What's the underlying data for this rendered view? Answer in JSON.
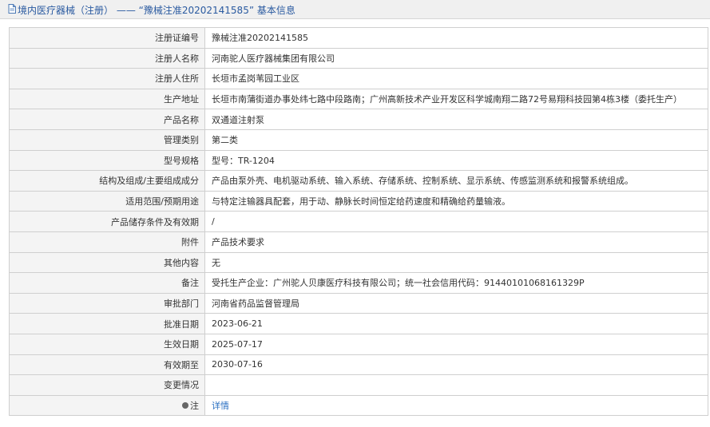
{
  "header": {
    "title": "境内医疗器械（注册） —— “豫械注准20202141585” 基本信息"
  },
  "rows": [
    {
      "label": "注册证编号",
      "value": "豫械注准20202141585"
    },
    {
      "label": "注册人名称",
      "value": "河南驼人医疗器械集团有限公司"
    },
    {
      "label": "注册人住所",
      "value": "长垣市孟岗苇园工业区"
    },
    {
      "label": "生产地址",
      "value": "长垣市南蒲街道办事处纬七路中段路南；广州高新技术产业开发区科学城南翔二路72号易翔科技园第4栋3楼（委托生产）"
    },
    {
      "label": "产品名称",
      "value": "双通道注射泵"
    },
    {
      "label": "管理类别",
      "value": "第二类"
    },
    {
      "label": "型号规格",
      "value": "型号：TR-1204"
    },
    {
      "label": "结构及组成/主要组成成分",
      "value": "产品由泵外壳、电机驱动系统、输入系统、存储系统、控制系统、显示系统、传感监测系统和报警系统组成。"
    },
    {
      "label": "适用范围/预期用途",
      "value": "与特定注输器具配套，用于动、静脉长时间恒定给药速度和精确给药量输液。"
    },
    {
      "label": "产品储存条件及有效期",
      "value": "/"
    },
    {
      "label": "附件",
      "value": "产品技术要求"
    },
    {
      "label": "其他内容",
      "value": "无"
    },
    {
      "label": "备注",
      "value": "受托生产企业：广州驼人贝康医疗科技有限公司；统一社会信用代码：91440101068161329P"
    },
    {
      "label": "审批部门",
      "value": "河南省药品监督管理局"
    },
    {
      "label": "批准日期",
      "value": "2023-06-21"
    },
    {
      "label": "生效日期",
      "value": "2025-07-17"
    },
    {
      "label": "有效期至",
      "value": "2030-07-16"
    },
    {
      "label": "变更情况",
      "value": ""
    }
  ],
  "note_row": {
    "label": "注",
    "link": "详情",
    "icon": "pin-icon"
  }
}
